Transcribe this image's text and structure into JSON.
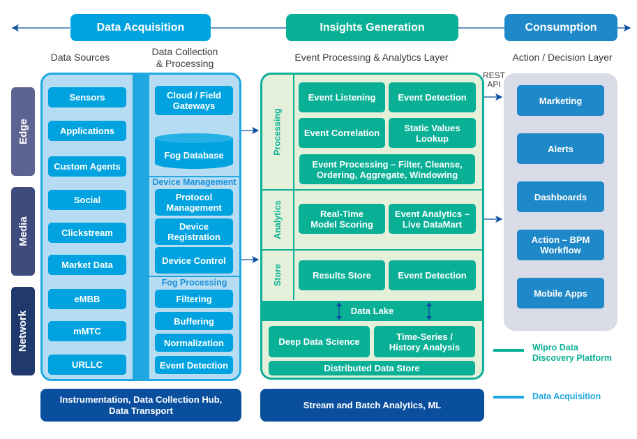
{
  "header": {
    "stages": [
      {
        "label": "Data Acquisition",
        "color": "#00a3e0"
      },
      {
        "label": "Insights Generation",
        "color": "#0ab096"
      },
      {
        "label": "Consumption",
        "color": "#1e88c9"
      }
    ],
    "subtitles": {
      "data_sources": "Data Sources",
      "data_collection": "Data Collection\n& Processing",
      "event_processing": "Event Processing & Analytics Layer",
      "action_layer": "Action / Decision Layer"
    }
  },
  "side_tabs": [
    {
      "label": "Edge",
      "color": "#5e6491"
    },
    {
      "label": "Media",
      "color": "#3f4a7d"
    },
    {
      "label": "Network",
      "color": "#203a6e"
    }
  ],
  "data_sources": [
    "Sensors",
    "Applications",
    "Custom Agents",
    "Social",
    "Clickstream",
    "Market Data",
    "eMBB",
    "mMTC",
    "URLLC"
  ],
  "data_collection": {
    "gateways": "Cloud / Field\nGateways",
    "fog_database": "Fog Database",
    "device_management": {
      "title": "Device Management",
      "items": [
        "Protocol\nManagement",
        "Device\nRegistration",
        "Device Control"
      ]
    },
    "fog_processing": {
      "title": "Fog Processing",
      "items": [
        "Filtering",
        "Buffering",
        "Normalization",
        "Event Detection"
      ]
    }
  },
  "insights": {
    "processing": {
      "label": "Processing",
      "items": [
        "Event Listening",
        "Event Detection",
        "Event Correlation",
        "Static Values\nLookup",
        "Event Processing – Filter, Cleanse,\nOrdering, Aggregate, Windowing"
      ]
    },
    "analytics": {
      "label": "Analytics",
      "items": [
        "Real-Time\nModel Scoring",
        "Event Analytics –\nLive DataMart"
      ]
    },
    "store": {
      "label": "Store",
      "items": [
        "Results Store",
        "Event Detection"
      ]
    },
    "data_lake": "Data Lake",
    "lake_items": [
      "Deep Data Science",
      "Time-Series /\nHistory Analysis"
    ],
    "distributed_store": "Distributed Data Store"
  },
  "rest_api": "REST\nAPI",
  "consumption": [
    "Marketing",
    "Alerts",
    "Dashboards",
    "Action – BPM\nWorkflow",
    "Mobile Apps"
  ],
  "bottom_bars": {
    "left": "Instrumentation, Data Collection Hub,\nData Transport",
    "middle": "Stream and Batch Analytics, ML"
  },
  "legend": [
    {
      "label": "Wipro Data\nDiscovery Platform",
      "color": "#0ab096"
    },
    {
      "label": "Data Acquisition",
      "color": "#1ea7e0"
    }
  ]
}
